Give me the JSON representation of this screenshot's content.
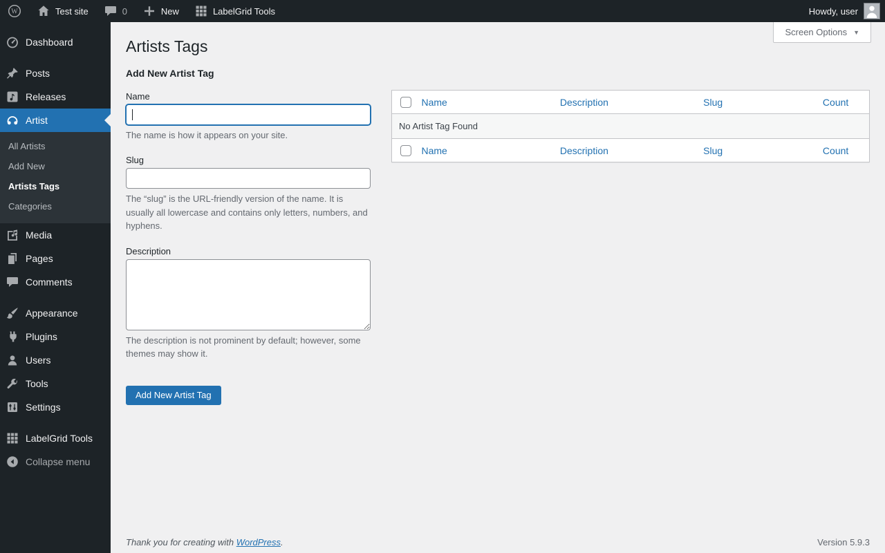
{
  "admin_bar": {
    "left": [
      {
        "name": "wp-logo",
        "icon": "wordpress"
      },
      {
        "name": "site-name",
        "icon": "home",
        "label": "Test site"
      },
      {
        "name": "comments",
        "icon": "comment",
        "label": "0",
        "dim_label": true
      },
      {
        "name": "new-content",
        "icon": "plus",
        "label": "New"
      },
      {
        "name": "labelgrid-tools",
        "icon": "grid",
        "label": "LabelGrid Tools"
      }
    ],
    "howdy": "Howdy, user"
  },
  "sidebar": {
    "items": [
      {
        "type": "item",
        "label": "Dashboard",
        "icon": "dashboard"
      },
      {
        "type": "separator"
      },
      {
        "type": "item",
        "label": "Posts",
        "icon": "pin"
      },
      {
        "type": "item",
        "label": "Releases",
        "icon": "music"
      },
      {
        "type": "item",
        "label": "Artist",
        "icon": "headphones",
        "active": true,
        "submenu": [
          {
            "label": "All Artists"
          },
          {
            "label": "Add New"
          },
          {
            "label": "Artists Tags",
            "current": true
          },
          {
            "label": "Categories"
          }
        ]
      },
      {
        "type": "item",
        "label": "Media",
        "icon": "media"
      },
      {
        "type": "item",
        "label": "Pages",
        "icon": "pages"
      },
      {
        "type": "item",
        "label": "Comments",
        "icon": "comment"
      },
      {
        "type": "separator"
      },
      {
        "type": "item",
        "label": "Appearance",
        "icon": "appearance"
      },
      {
        "type": "item",
        "label": "Plugins",
        "icon": "plugins"
      },
      {
        "type": "item",
        "label": "Users",
        "icon": "users"
      },
      {
        "type": "item",
        "label": "Tools",
        "icon": "tools"
      },
      {
        "type": "item",
        "label": "Settings",
        "icon": "settings"
      },
      {
        "type": "separator"
      },
      {
        "type": "item",
        "label": "LabelGrid Tools",
        "icon": "grid"
      },
      {
        "type": "item",
        "label": "Collapse menu",
        "icon": "collapse",
        "muted": true
      }
    ]
  },
  "page": {
    "title": "Artists Tags",
    "screen_options": "Screen Options",
    "form": {
      "heading": "Add New Artist Tag",
      "name_label": "Name",
      "name_value": "",
      "name_help": "The name is how it appears on your site.",
      "slug_label": "Slug",
      "slug_value": "",
      "slug_help": "The “slug” is the URL-friendly version of the name. It is usually all lowercase and contains only letters, numbers, and hyphens.",
      "description_label": "Description",
      "description_value": "",
      "description_help": "The description is not prominent by default; however, some themes may show it.",
      "submit_label": "Add New Artist Tag"
    },
    "table": {
      "columns": [
        "Name",
        "Description",
        "Slug",
        "Count"
      ],
      "empty_message": "No Artist Tag Found"
    },
    "footer": {
      "thanks_prefix": "Thank you for creating with ",
      "thanks_link": "WordPress",
      "thanks_suffix": ".",
      "version": "Version 5.9.3"
    }
  },
  "colors": {
    "accent_blue": "#2271b1",
    "admin_dark": "#1d2327",
    "submenu_dark": "#2c3338",
    "content_bg": "#f0f0f1",
    "border": "#c3c4c7",
    "muted_text": "#646970"
  }
}
